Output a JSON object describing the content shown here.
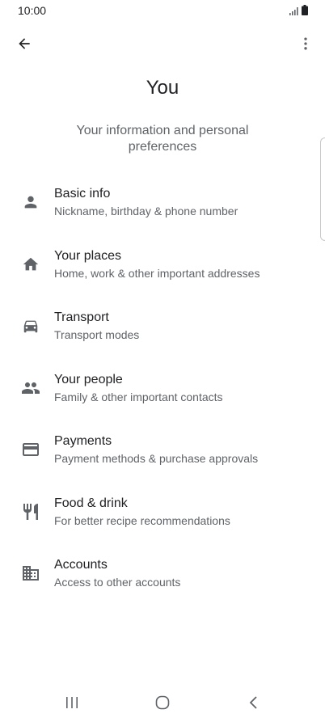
{
  "status": {
    "time": "10:00"
  },
  "header": {
    "title": "You",
    "subtitle": "Your information and personal preferences"
  },
  "menu": {
    "items": [
      {
        "title": "Basic info",
        "subtitle": "Nickname, birthday & phone number",
        "icon": "person-icon"
      },
      {
        "title": "Your places",
        "subtitle": "Home, work & other important addresses",
        "icon": "home-icon"
      },
      {
        "title": "Transport",
        "subtitle": "Transport modes",
        "icon": "car-icon"
      },
      {
        "title": "Your people",
        "subtitle": "Family & other important contacts",
        "icon": "people-icon"
      },
      {
        "title": "Payments",
        "subtitle": "Payment methods & purchase approvals",
        "icon": "credit-card-icon"
      },
      {
        "title": "Food & drink",
        "subtitle": "For better recipe recommendations",
        "icon": "restaurant-icon"
      },
      {
        "title": "Accounts",
        "subtitle": "Access to other accounts",
        "icon": "building-icon"
      }
    ]
  },
  "colors": {
    "icon": "#5f6368",
    "text": "#202124",
    "secondary": "#5f6368"
  }
}
